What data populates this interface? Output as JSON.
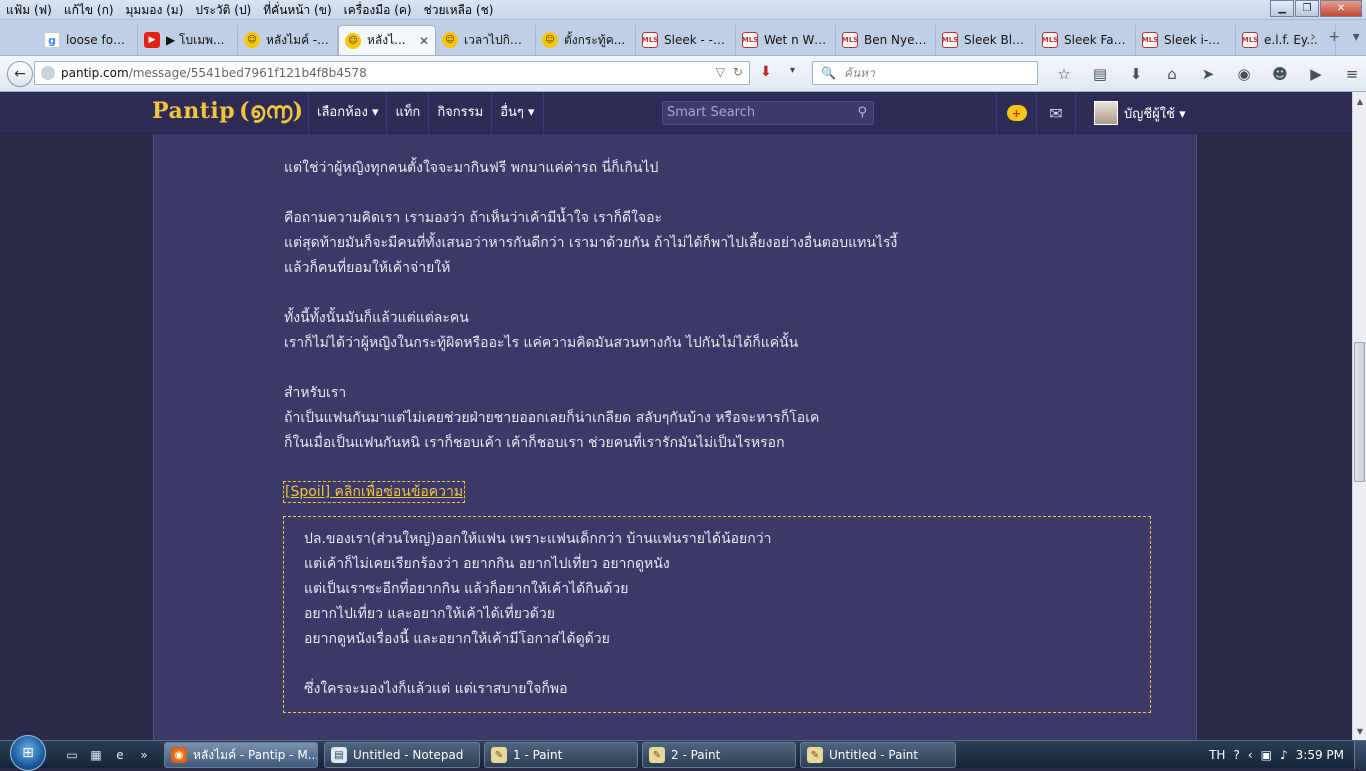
{
  "menu": {
    "items": [
      "แฟ้ม (ฟ)",
      "แก้ไข (ก)",
      "มุมมอง (ม)",
      "ประวัติ (ป)",
      "ที่คั่นหน้า (ข)",
      "เครื่องมือ (ค)",
      "ช่วยเหลือ (ช)"
    ]
  },
  "tabs": [
    {
      "title": "loose fou...",
      "icon": "google-icon",
      "glyph": "g"
    },
    {
      "title": "▶ โบเมพ...",
      "icon": "youtube-icon",
      "glyph": "▶"
    },
    {
      "title": "หลังไมค์ -...",
      "icon": "pantip-smile-icon",
      "glyph": "☺"
    },
    {
      "title": "หลังไ...",
      "icon": "pantip-smile-icon",
      "glyph": "☺",
      "active": true
    },
    {
      "title": "เวลาไปกิน...",
      "icon": "pantip-smile-icon",
      "glyph": "☺"
    },
    {
      "title": "ตั้งกระทู้ค...",
      "icon": "pantip-smile-icon",
      "glyph": "☺"
    },
    {
      "title": "Sleek - -- ...",
      "icon": "mls-icon",
      "glyph": "MLS"
    },
    {
      "title": "Wet n Wil...",
      "icon": "mls-icon",
      "glyph": "MLS"
    },
    {
      "title": "Ben Nye ...",
      "icon": "mls-icon",
      "glyph": "MLS"
    },
    {
      "title": "Sleek Blu...",
      "icon": "mls-icon",
      "glyph": "MLS"
    },
    {
      "title": "Sleek Fac...",
      "icon": "mls-icon",
      "glyph": "MLS"
    },
    {
      "title": "Sleek i-Di...",
      "icon": "mls-icon",
      "glyph": "MLS"
    },
    {
      "title": "e.l.f. Ey...",
      "icon": "mls-icon",
      "glyph": "MLS"
    }
  ],
  "nav": {
    "url_domain": "pantip.com",
    "url_path": "/message/5541bed7961f121b4f8b4578",
    "search_placeholder": "ค้นหา"
  },
  "site": {
    "logo": "Pantip",
    "logo_glyph": "(൭൬)",
    "nav_items": [
      "เลือกห้อง ▾",
      "แท็ก",
      "กิจกรรม",
      "อื่นๆ ▾"
    ],
    "search_placeholder": "Smart Search",
    "account_label": "บัญชีผู้ใช้ ▾"
  },
  "message": {
    "lines": [
      "แต่ใช่ว่าผู้หญิงทุกคนตั้งใจจะมากินฟรี พกมาแค่ค่ารถ นี่ก็เกินไป",
      "",
      "คือถามความคิดเรา เรามองว่า ถ้าเห็นว่าเค้ามีน้ำใจ เราก็ดีใจอะ",
      "แต่สุดท้ายมันก็จะมีคนที่ทั้งเสนอว่าหารกันดีกว่า เรามาด้วยกัน ถ้าไม่ได้ก็พาไปเลี้ยงอย่างอื่นตอบแทนไรงี้",
      "แล้วก็คนที่ยอมให้เค้าจ่ายให้",
      "",
      "ทั้งนี้ทั้งนั้นมันก็แล้วแต่แต่ละคน",
      "เราก็ไม่ได้ว่าผู้หญิงในกระทู้ผิดหรืออะไร แค่ความคิดมันสวนทางกัน ไปกันไม่ได้ก็แค่นั้น",
      "",
      "สำหรับเรา",
      "ถ้าเป็นแฟนกันมาแต่ไม่เคยช่วยฝ่ายชายออกเลยก็น่าเกลียด สลับๆกันบ้าง หรือจะหารก็โอเค",
      "ก็ในเมื่อเป็นแฟนกันหนิ เราก็ชอบเค้า เค้าก็ชอบเรา ช่วยคนที่เรารักมันไม่เป็นไรหรอก"
    ],
    "spoiler_link": "[Spoil] คลิกเพื่อซ่อนข้อความ",
    "spoiler_lines": [
      "ปล.ของเรา(ส่วนใหญ่)ออกให้แฟน เพราะแฟนเด็กกว่า บ้านแฟนรายได้น้อยกว่า",
      "แต่เค้าก็ไม่เคยเรียกร้องว่า อยากกิน อยากไปเที่ยว อยากดูหนัง",
      "แต่เป็นเราซะอีกที่อยากกิน แล้วก็อยากให้เค้าได้กินด้วย",
      "อยากไปเที่ยว และอยากให้เค้าได้เที่ยวด้วย",
      "อยากดูหนังเรื่องนี้ และอยากให้เค้ามีโอกาสได้ดูด้วย",
      "",
      "ซึ่งใครจะมองไงก็แล้วแต่ แต่เราสบายใจก็พอ"
    ]
  },
  "taskbar": {
    "buttons": [
      {
        "label": "หลังไมค์ - Pantip - M...",
        "icon": "firefox-icon",
        "active": true
      },
      {
        "label": "Untitled - Notepad",
        "icon": "notepad-icon"
      },
      {
        "label": "1 - Paint",
        "icon": "paint-icon"
      },
      {
        "label": "2 - Paint",
        "icon": "paint-icon"
      },
      {
        "label": "Untitled - Paint",
        "icon": "paint-icon"
      }
    ],
    "language": "TH",
    "clock": "3:59 PM"
  },
  "colors": {
    "accent": "#f2c53d",
    "header_bg": "#2e2c56",
    "content_bg": "#3b3968"
  }
}
